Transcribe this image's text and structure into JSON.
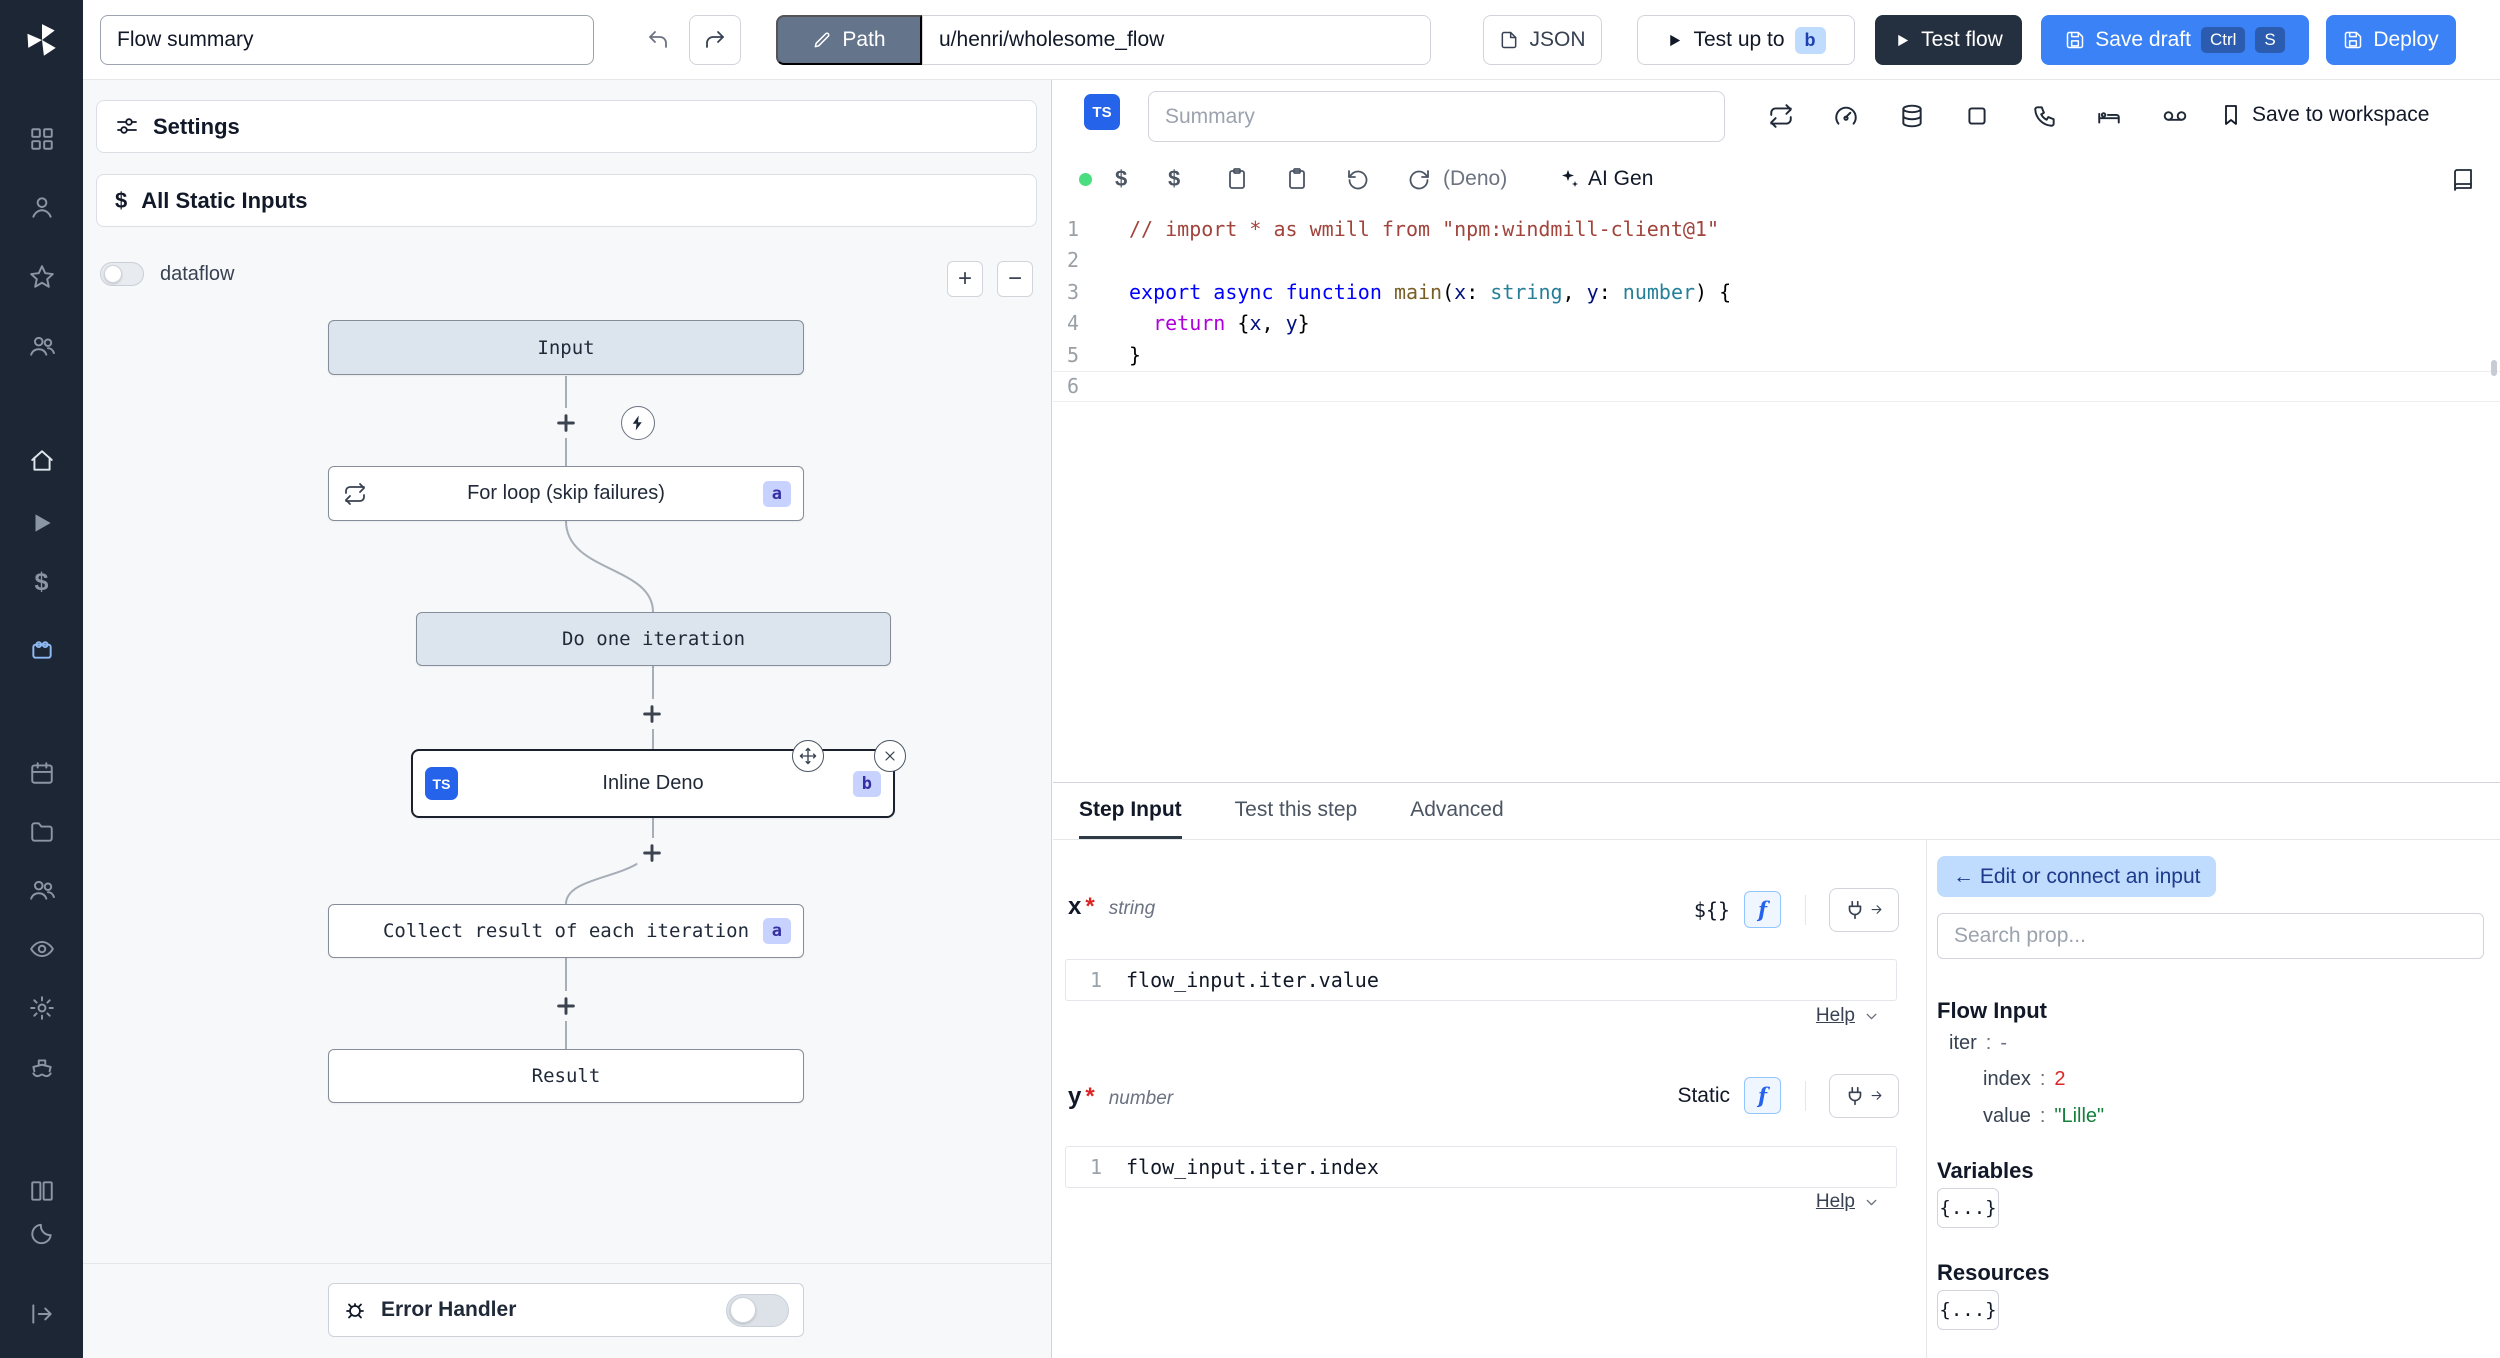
{
  "colors": {
    "primary_blue": "#3b82f6",
    "dark_button": "#24303f",
    "sidebar_bg": "#1c2634",
    "node_fill": "#dce5ee",
    "badge_bg": "#c7d2fe",
    "number_red": "#dc2626",
    "string_green": "#15803d",
    "status_green": "#4ade80"
  },
  "topbar": {
    "flow_summary_value": "Flow summary",
    "path_label": "Path",
    "path_value": "u/henri/wholesome_flow",
    "json_label": "JSON",
    "test_up_to_label": "Test up to",
    "test_up_to_badge": "b",
    "test_flow_label": "Test flow",
    "save_draft_label": "Save draft",
    "kbd_ctrl": "Ctrl",
    "kbd_s": "S",
    "deploy_label": "Deploy"
  },
  "flow_panel": {
    "settings_label": "Settings",
    "static_inputs_label": "All Static Inputs",
    "static_inputs_icon": "$",
    "dataflow_label": "dataflow",
    "zoom_in_label": "+",
    "zoom_out_label": "−",
    "nodes": {
      "input_label": "Input",
      "forloop_label": "For loop (skip failures)",
      "forloop_badge": "a",
      "iteration_label": "Do one iteration",
      "inline_lang": "TS",
      "inline_label": "Inline Deno",
      "inline_badge": "b",
      "collect_label": "Collect result of each iteration",
      "collect_badge": "a",
      "result_label": "Result"
    },
    "error_handler_label": "Error Handler"
  },
  "editor": {
    "lang_badge": "TS",
    "summary_placeholder": "Summary",
    "save_to_workspace_label": "Save to workspace",
    "dollar_btn_1": "$",
    "dollar_btn_2": "$",
    "deno_label": "(Deno)",
    "ai_gen_label": "AI Gen",
    "code_lines": [
      {
        "num": "1",
        "tokens": [
          {
            "c": "comment",
            "t": "// import * as wmill from \"npm:windmill-client@1\""
          }
        ]
      },
      {
        "num": "2",
        "tokens": []
      },
      {
        "num": "3",
        "tokens": [
          {
            "c": "kw",
            "t": "export"
          },
          {
            "c": "pl",
            "t": " "
          },
          {
            "c": "kw",
            "t": "async"
          },
          {
            "c": "pl",
            "t": " "
          },
          {
            "c": "kw",
            "t": "function"
          },
          {
            "c": "pl",
            "t": " "
          },
          {
            "c": "fn",
            "t": "main"
          },
          {
            "c": "pl",
            "t": "("
          },
          {
            "c": "vr",
            "t": "x"
          },
          {
            "c": "pl",
            "t": ": "
          },
          {
            "c": "ty",
            "t": "string"
          },
          {
            "c": "pl",
            "t": ", "
          },
          {
            "c": "vr",
            "t": "y"
          },
          {
            "c": "pl",
            "t": ": "
          },
          {
            "c": "ty",
            "t": "number"
          },
          {
            "c": "pl",
            "t": ") {"
          }
        ]
      },
      {
        "num": "4",
        "tokens": [
          {
            "c": "pl",
            "t": "  "
          },
          {
            "c": "kw2",
            "t": "return"
          },
          {
            "c": "pl",
            "t": " {"
          },
          {
            "c": "vr",
            "t": "x"
          },
          {
            "c": "pl",
            "t": ", "
          },
          {
            "c": "vr",
            "t": "y"
          },
          {
            "c": "pl",
            "t": "}"
          }
        ]
      },
      {
        "num": "5",
        "tokens": [
          {
            "c": "pl",
            "t": "}"
          }
        ]
      },
      {
        "num": "6",
        "tokens": []
      }
    ]
  },
  "step_panel": {
    "tabs": [
      {
        "label": "Step Input"
      },
      {
        "label": "Test this step"
      },
      {
        "label": "Advanced"
      }
    ],
    "x_field": {
      "name": "x",
      "required": "*",
      "type": "string",
      "mode": "${}",
      "f": "f",
      "line_no": "1",
      "expr": "flow_input.iter.value",
      "help": "Help"
    },
    "y_field": {
      "name": "y",
      "required": "*",
      "type": "number",
      "mode": "Static",
      "f": "f",
      "line_no": "1",
      "expr": "flow_input.iter.index",
      "help": "Help"
    }
  },
  "prop_picker": {
    "edit_connect_label": "← Edit or connect an input",
    "search_placeholder": "Search prop...",
    "flow_input_title": "Flow Input",
    "sep": ":",
    "iter_key": "iter",
    "iter_value": "-",
    "index_key": "index",
    "index_value": "2",
    "value_key": "value",
    "value_value": "\"Lille\"",
    "variables_title": "Variables",
    "variables_btn": "{...}",
    "resources_title": "Resources",
    "resources_btn": "{...}"
  }
}
